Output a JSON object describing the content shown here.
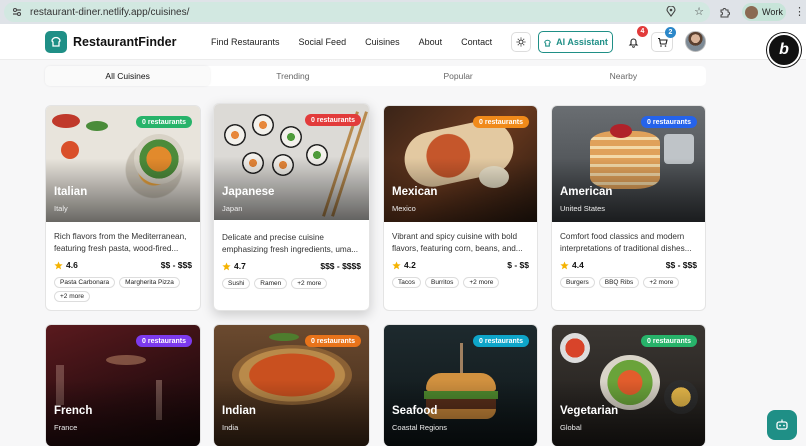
{
  "browser": {
    "url": "restaurant-diner.netlify.app/cuisines/",
    "profile_label": "Work"
  },
  "nav": {
    "brand": "RestaurantFinder",
    "links": [
      "Find Restaurants",
      "Social Feed",
      "Cuisines",
      "About",
      "Contact"
    ],
    "ai_label": "AI Assistant",
    "notification_count": "4",
    "cart_count": "2",
    "bolt_letter": "b"
  },
  "tabs": [
    "All Cuisines",
    "Trending",
    "Popular",
    "Nearby"
  ],
  "cuisines": [
    {
      "name": "Italian",
      "region": "Italy",
      "badge": "0 restaurants",
      "badge_color": "#27b36a",
      "desc": "Rich flavors from the Mediterranean, featuring fresh pasta, wood-fired...",
      "rating": "4.6",
      "price": "$$ - $$$",
      "tags": [
        "Pasta Carbonara",
        "Margherita Pizza",
        "+2 more"
      ]
    },
    {
      "name": "Japanese",
      "region": "Japan",
      "badge": "0 restaurants",
      "badge_color": "#e23b3b",
      "desc": "Delicate and precise cuisine emphasizing fresh ingredients, uma...",
      "rating": "4.7",
      "price": "$$$ - $$$$",
      "tags": [
        "Sushi",
        "Ramen",
        "+2 more"
      ]
    },
    {
      "name": "Mexican",
      "region": "Mexico",
      "badge": "0 restaurants",
      "badge_color": "#f08a1a",
      "desc": "Vibrant and spicy cuisine with bold flavors, featuring corn, beans, and...",
      "rating": "4.2",
      "price": "$ - $$",
      "tags": [
        "Tacos",
        "Burritos",
        "+2 more"
      ]
    },
    {
      "name": "American",
      "region": "United States",
      "badge": "0 restaurants",
      "badge_color": "#2563eb",
      "desc": "Comfort food classics and modern interpretations of traditional dishes...",
      "rating": "4.4",
      "price": "$$ - $$$",
      "tags": [
        "Burgers",
        "BBQ Ribs",
        "+2 more"
      ]
    },
    {
      "name": "French",
      "region": "France",
      "badge": "0 restaurants",
      "badge_color": "#7c3aed"
    },
    {
      "name": "Indian",
      "region": "India",
      "badge": "0 restaurants",
      "badge_color": "#e8731a"
    },
    {
      "name": "Seafood",
      "region": "Coastal Regions",
      "badge": "0 restaurants",
      "badge_color": "#0ea5c9"
    },
    {
      "name": "Vegetarian",
      "region": "Global",
      "badge": "0 restaurants",
      "badge_color": "#27b36a"
    }
  ]
}
